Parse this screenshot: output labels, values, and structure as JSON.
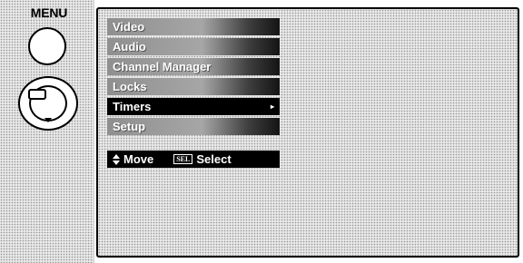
{
  "remote": {
    "menu_label": "MENU"
  },
  "menu": {
    "items": [
      {
        "label": "Video"
      },
      {
        "label": "Audio"
      },
      {
        "label": "Channel Manager"
      },
      {
        "label": "Locks"
      },
      {
        "label": "Timers",
        "selected": true,
        "arrow": "▸"
      },
      {
        "label": "Setup"
      }
    ]
  },
  "nav": {
    "move_label": "Move",
    "sel_key": "SEL",
    "select_label": "Select"
  }
}
